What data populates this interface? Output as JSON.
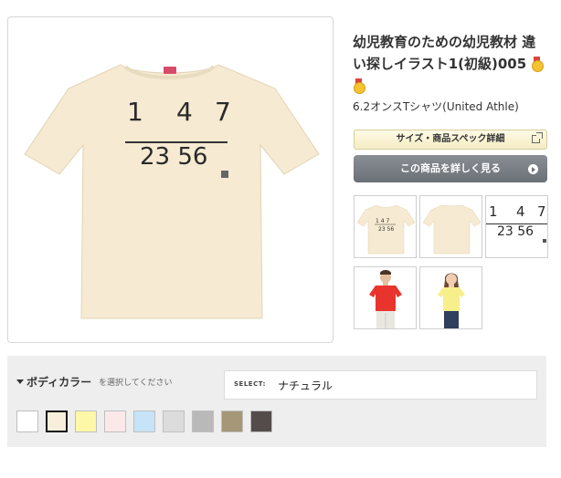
{
  "product": {
    "title_line1": "幼児教育のための幼児教材 違",
    "title_line2": "い探しイラスト1(初級)005",
    "subtitle": "6.2オンスTシャツ(United Athle)",
    "print_top": [
      "1",
      "4",
      "7"
    ],
    "print_bottom": "23 56",
    "shirt_color": "#f6ead2"
  },
  "buttons": {
    "spec_label": "サイズ・商品スペック詳細",
    "detail_label": "この商品を詳しく見る"
  },
  "thumbnails": {
    "zoom_top": [
      "1",
      "4",
      "7"
    ],
    "zoom_bottom": "23 56",
    "model_male_shirt": "#e8342d",
    "model_female_shirt": "#f6ef8b"
  },
  "color_selector": {
    "label": "ボディカラー",
    "hint": "を選択してください",
    "select_tag": "SELECT:",
    "selected_value": "ナチュラル",
    "swatches": [
      {
        "name": "white",
        "color": "#ffffff"
      },
      {
        "name": "natural",
        "color": "#f7efdb",
        "selected": true
      },
      {
        "name": "light-yellow",
        "color": "#fdf7a8"
      },
      {
        "name": "light-pink",
        "color": "#fbe9ea"
      },
      {
        "name": "light-blue",
        "color": "#c6e3f7"
      },
      {
        "name": "heather-light",
        "color": "#dcdcdc"
      },
      {
        "name": "heather-gray",
        "color": "#b9b9b9"
      },
      {
        "name": "sand",
        "color": "#a59777"
      },
      {
        "name": "charcoal",
        "color": "#544c4a"
      }
    ]
  }
}
